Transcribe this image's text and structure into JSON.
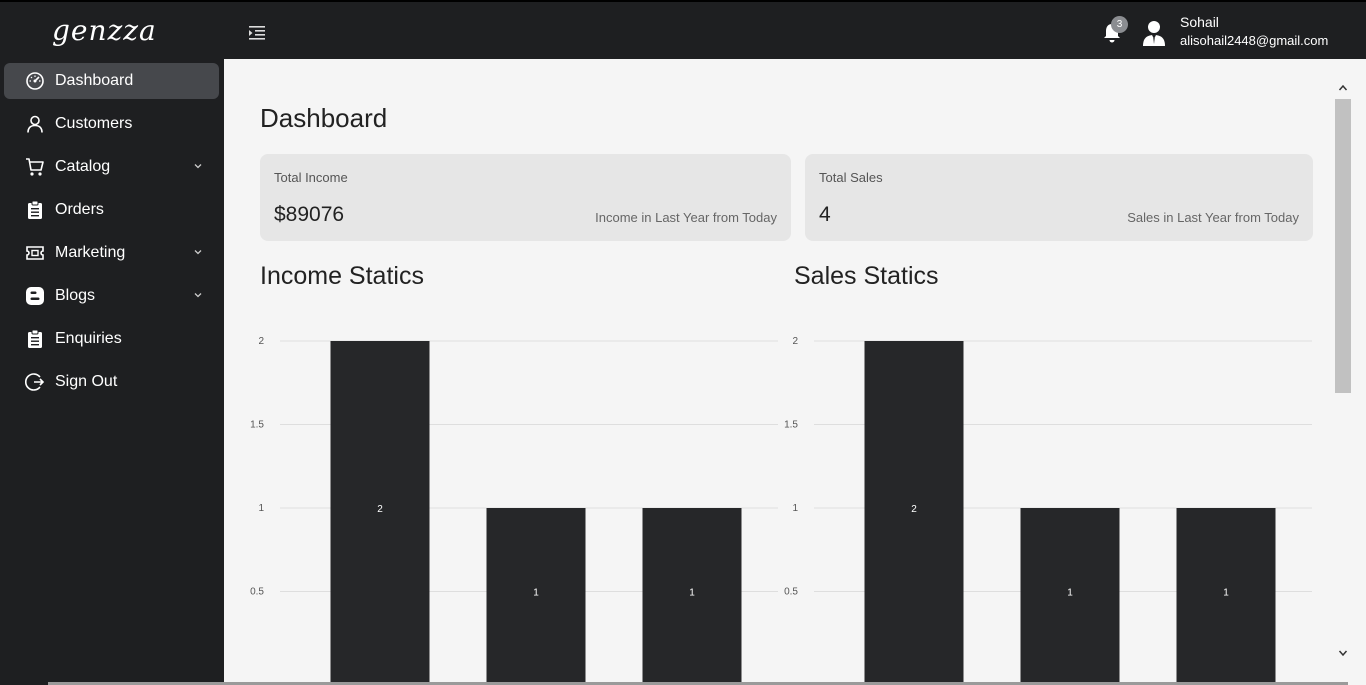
{
  "header": {
    "logo_text": "genzza",
    "notifications_count": "3",
    "user_name": "Sohail",
    "user_email": "alisohail2448@gmail.com"
  },
  "sidebar": {
    "items": [
      {
        "label": "Dashboard",
        "icon": "dashboard-icon",
        "has_submenu": false,
        "active": true
      },
      {
        "label": "Customers",
        "icon": "user-icon",
        "has_submenu": false,
        "active": false
      },
      {
        "label": "Catalog",
        "icon": "cart-icon",
        "has_submenu": true,
        "active": false
      },
      {
        "label": "Orders",
        "icon": "clipboard-icon",
        "has_submenu": false,
        "active": false
      },
      {
        "label": "Marketing",
        "icon": "ticket-icon",
        "has_submenu": true,
        "active": false
      },
      {
        "label": "Blogs",
        "icon": "blogger-icon",
        "has_submenu": true,
        "active": false
      },
      {
        "label": "Enquiries",
        "icon": "clipboard-icon",
        "has_submenu": false,
        "active": false
      },
      {
        "label": "Sign Out",
        "icon": "sign-out-icon",
        "has_submenu": false,
        "active": false
      }
    ]
  },
  "main": {
    "title": "Dashboard",
    "cards": [
      {
        "title": "Total Income",
        "value": "$89076",
        "description": "Income in Last Year from Today"
      },
      {
        "title": "Total Sales",
        "value": "4",
        "description": "Sales in Last Year from Today"
      }
    ],
    "income_title": "Income Statics",
    "sales_title": "Sales Statics"
  },
  "colors": {
    "sidebar_bg": "#1e1f21",
    "active_item": "#46484c",
    "bar": "#262729",
    "main_bg": "#f5f5f5",
    "card_bg": "#e6e6e6"
  },
  "chart_data": [
    {
      "type": "bar",
      "values": [
        2,
        1,
        1
      ],
      "data_labels": [
        "2",
        "1",
        "1"
      ],
      "ylim": [
        0,
        2
      ],
      "yticks": [
        "0.5",
        "1",
        "1.5",
        "2"
      ],
      "grid": true
    },
    {
      "type": "bar",
      "values": [
        2,
        1,
        1
      ],
      "data_labels": [
        "2",
        "1",
        "1"
      ],
      "ylim": [
        0,
        2
      ],
      "yticks": [
        "0.5",
        "1",
        "1.5",
        "2"
      ],
      "grid": true
    }
  ]
}
